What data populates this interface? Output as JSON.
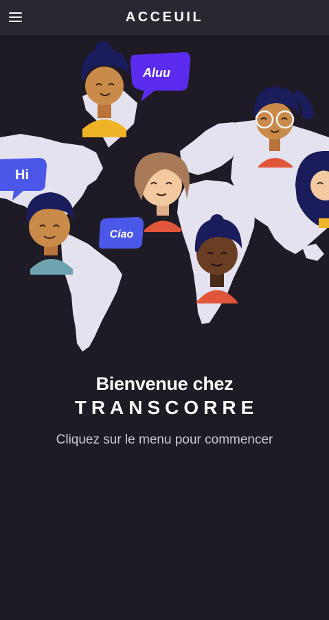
{
  "appbar": {
    "title": "ACCEUIL",
    "menu_icon": "menu-icon"
  },
  "illustration": {
    "bubbles": {
      "aluu": "Aluu",
      "hi": "Hi",
      "ciao": "Ciao"
    },
    "colors": {
      "map": "#e4e2ef",
      "bubble_purple": "#5b2cf0",
      "bubble_blue": "#4a57e8"
    }
  },
  "welcome": {
    "line1": "Bienvenue chez",
    "brand": "TRANSCORRE",
    "subtitle": "Cliquez sur le menu pour commencer"
  }
}
